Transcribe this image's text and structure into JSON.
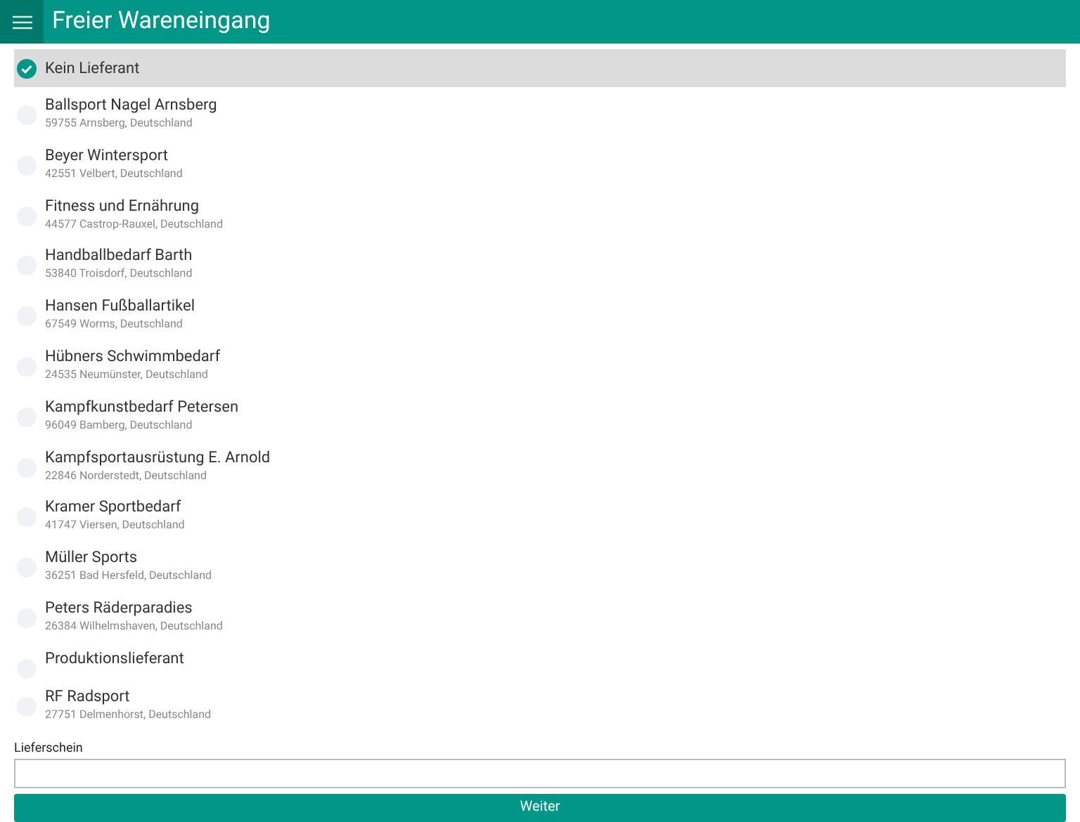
{
  "header": {
    "title": "Freier Wareneingang"
  },
  "suppliers": [
    {
      "name": "Kein Lieferant",
      "selected": true
    },
    {
      "name": "Ballsport Nagel Arnsberg",
      "address": "59755 Arnsberg, Deutschland",
      "selected": false
    },
    {
      "name": "Beyer Wintersport",
      "address": "42551 Velbert, Deutschland",
      "selected": false
    },
    {
      "name": "Fitness und Ernährung",
      "address": "44577 Castrop-Rauxel, Deutschland",
      "selected": false
    },
    {
      "name": "Handballbedarf Barth",
      "address": "53840 Troisdorf, Deutschland",
      "selected": false
    },
    {
      "name": "Hansen Fußballartikel",
      "address": "67549 Worms, Deutschland",
      "selected": false
    },
    {
      "name": "Hübners Schwimmbedarf",
      "address": "24535 Neumünster, Deutschland",
      "selected": false
    },
    {
      "name": "Kampfkunstbedarf Petersen",
      "address": "96049 Bamberg, Deutschland",
      "selected": false
    },
    {
      "name": "Kampfsportausrüstung E. Arnold",
      "address": "22846 Norderstedt, Deutschland",
      "selected": false
    },
    {
      "name": "Kramer Sportbedarf",
      "address": "41747 Viersen, Deutschland",
      "selected": false
    },
    {
      "name": "Müller Sports",
      "address": "36251 Bad Hersfeld, Deutschland",
      "selected": false
    },
    {
      "name": "Peters Räderparadies",
      "address": "26384 Wilhelmshaven, Deutschland",
      "selected": false
    },
    {
      "name": "Produktionslieferant",
      "selected": false
    },
    {
      "name": "RF Radsport",
      "address": "27751 Delmenhorst, Deutschland",
      "selected": false
    }
  ],
  "delivery_note": {
    "label": "Lieferschein"
  },
  "submit_button": "Weiter"
}
